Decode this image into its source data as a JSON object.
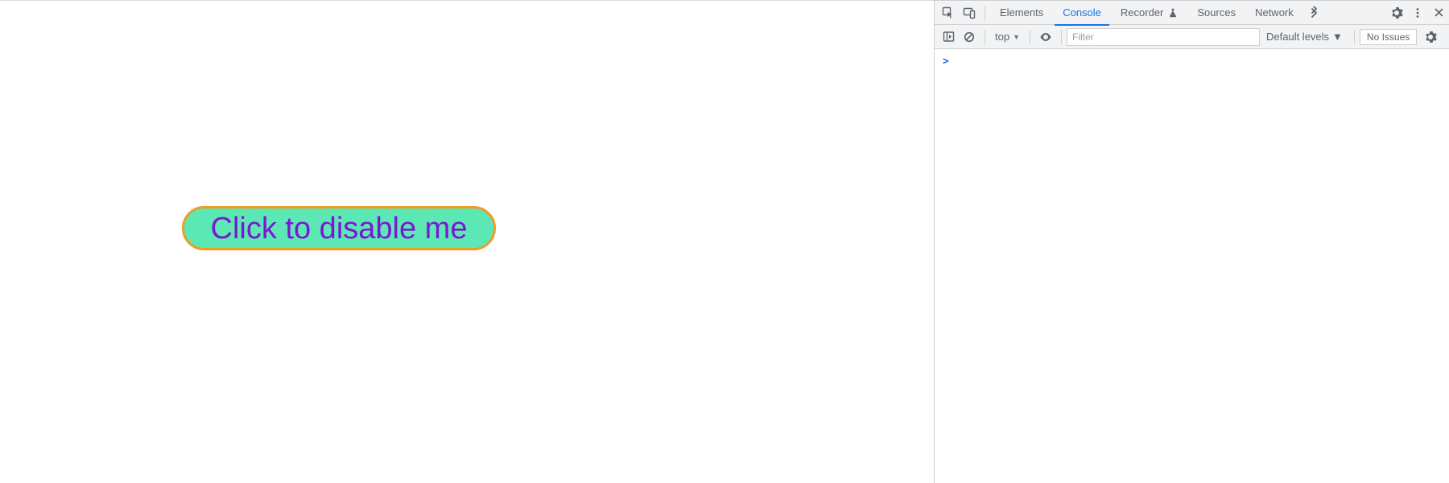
{
  "page": {
    "button_label": "Click to disable me"
  },
  "devtools": {
    "tabs": {
      "elements": "Elements",
      "console": "Console",
      "recorder": "Recorder",
      "sources": "Sources",
      "network": "Network"
    },
    "toolbar": {
      "context_label": "top",
      "filter_placeholder": "Filter",
      "levels_label": "Default levels",
      "issues_label": "No Issues"
    },
    "console_prompt": ">"
  }
}
